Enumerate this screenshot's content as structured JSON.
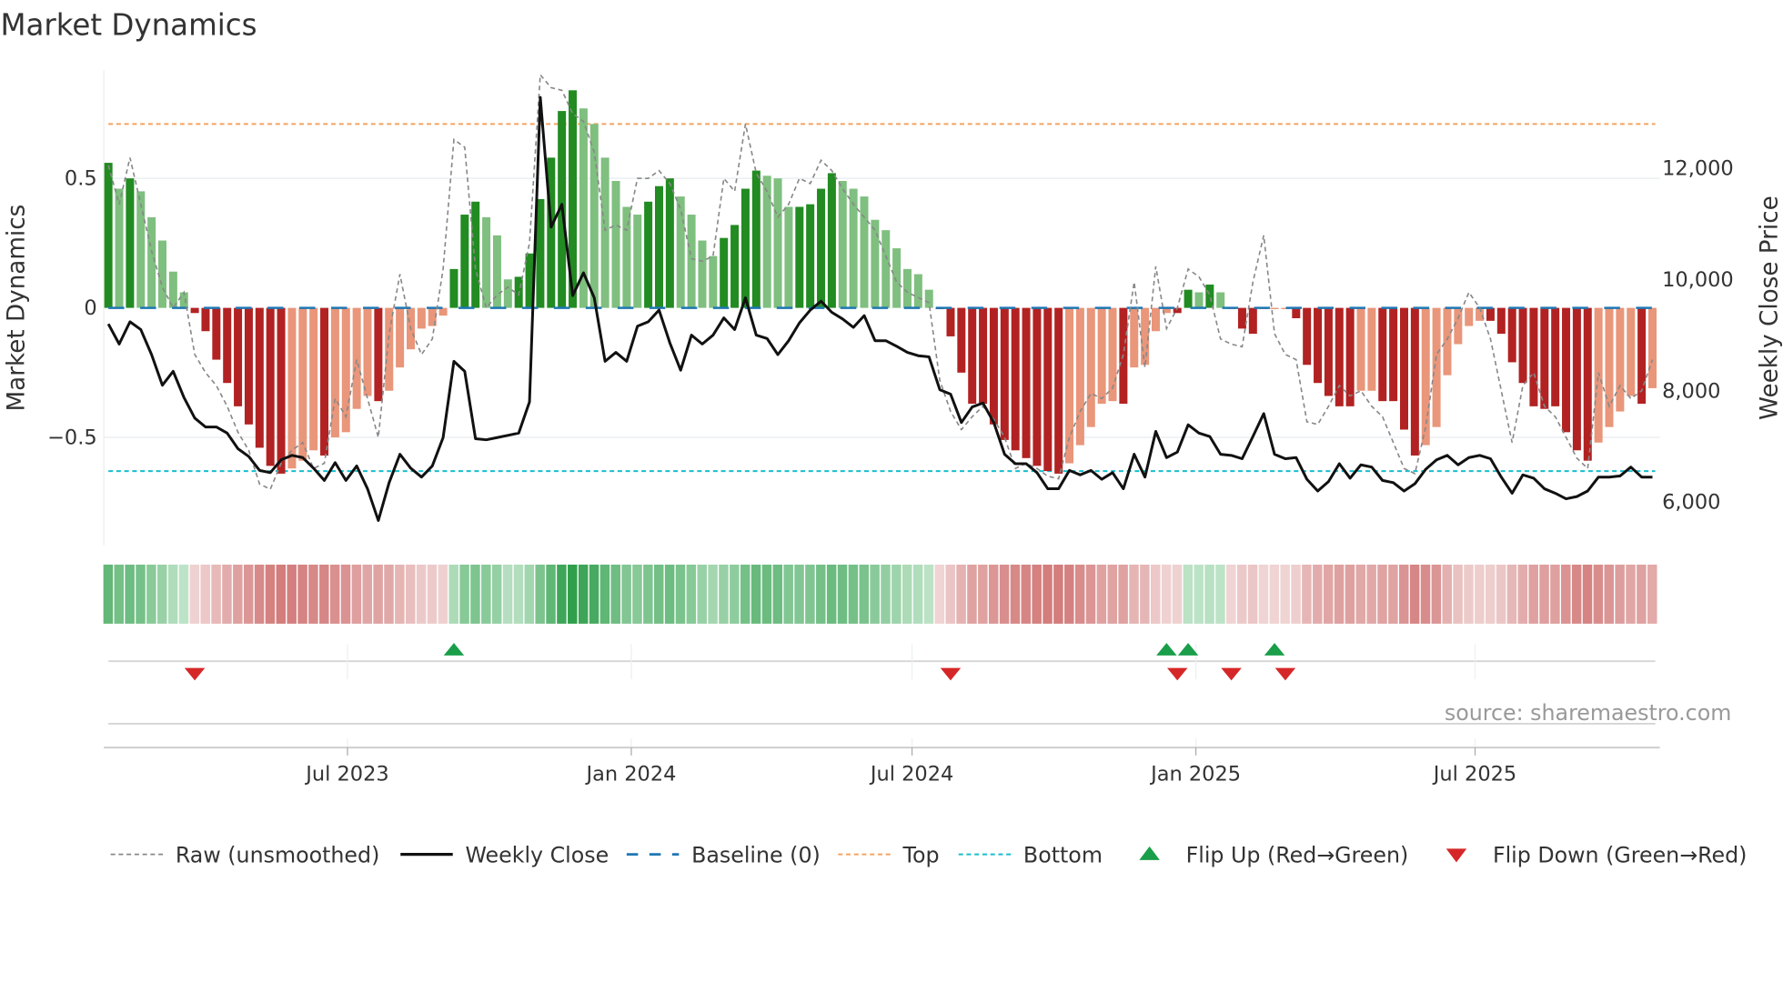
{
  "chart_data": {
    "type": "bar",
    "title": "Market Dynamics",
    "ylabel": "Market Dynamics",
    "y2label": "Weekly Close Price",
    "ylim": [
      -0.92,
      0.92
    ],
    "y2lim": [
      5200,
      13900
    ],
    "yticks": [
      {
        "v": 0.5,
        "label": "0.5"
      },
      {
        "v": 0,
        "label": "0"
      },
      {
        "v": -0.5,
        "label": "−0.5"
      }
    ],
    "y2ticks": [
      {
        "v": 12000,
        "label": "12,000"
      },
      {
        "v": 10000,
        "label": "10,000"
      },
      {
        "v": 8000,
        "label": "8,000"
      },
      {
        "v": 6000,
        "label": "6,000"
      }
    ],
    "x_start": "2023-01-27",
    "x_step_days": 7,
    "xticks": [
      {
        "date": "2023-07-01",
        "label": "Jul 2023"
      },
      {
        "date": "2024-01-01",
        "label": "Jan 2024"
      },
      {
        "date": "2024-07-01",
        "label": "Jul 2024"
      },
      {
        "date": "2025-01-01",
        "label": "Jan 2025"
      },
      {
        "date": "2025-07-01",
        "label": "Jul 2025"
      }
    ],
    "top_level": 0.71,
    "bottom_level": -0.63,
    "baseline": 0,
    "dynamics": [
      0.56,
      0.46,
      0.5,
      0.45,
      0.35,
      0.26,
      0.14,
      0.06,
      -0.02,
      -0.09,
      -0.2,
      -0.29,
      -0.38,
      -0.45,
      -0.54,
      -0.61,
      -0.64,
      -0.62,
      -0.59,
      -0.55,
      -0.57,
      -0.5,
      -0.48,
      -0.39,
      -0.34,
      -0.36,
      -0.32,
      -0.23,
      -0.16,
      -0.08,
      -0.07,
      -0.03,
      0.15,
      0.36,
      0.41,
      0.35,
      0.28,
      0.11,
      0.12,
      0.21,
      0.42,
      0.58,
      0.76,
      0.84,
      0.77,
      0.71,
      0.58,
      0.49,
      0.39,
      0.36,
      0.41,
      0.47,
      0.5,
      0.43,
      0.36,
      0.26,
      0.2,
      0.27,
      0.32,
      0.46,
      0.53,
      0.51,
      0.5,
      0.39,
      0.39,
      0.4,
      0.46,
      0.52,
      0.49,
      0.46,
      0.43,
      0.34,
      0.3,
      0.23,
      0.15,
      0.13,
      0.07,
      -0.005,
      -0.11,
      -0.25,
      -0.37,
      -0.37,
      -0.45,
      -0.51,
      -0.55,
      -0.58,
      -0.61,
      -0.63,
      -0.64,
      -0.6,
      -0.53,
      -0.46,
      -0.37,
      -0.36,
      -0.37,
      -0.23,
      -0.22,
      -0.09,
      -0.02,
      -0.02,
      0.07,
      0.06,
      0.09,
      0.06,
      -0.005,
      -0.08,
      -0.1,
      -0.005,
      -0.005,
      -0.005,
      -0.04,
      -0.22,
      -0.29,
      -0.34,
      -0.38,
      -0.38,
      -0.32,
      -0.32,
      -0.36,
      -0.36,
      -0.47,
      -0.57,
      -0.53,
      -0.46,
      -0.26,
      -0.14,
      -0.07,
      -0.05,
      -0.05,
      -0.1,
      -0.21,
      -0.29,
      -0.38,
      -0.39,
      -0.38,
      -0.48,
      -0.55,
      -0.59,
      -0.52,
      -0.46,
      -0.4,
      -0.34,
      -0.37,
      -0.31
    ],
    "strong": [
      1,
      0,
      1,
      0,
      0,
      0,
      0,
      0,
      1,
      1,
      1,
      1,
      1,
      1,
      1,
      1,
      1,
      0,
      0,
      0,
      1,
      0,
      0,
      0,
      0,
      1,
      0,
      0,
      0,
      0,
      0,
      0,
      1,
      1,
      1,
      0,
      0,
      0,
      1,
      1,
      1,
      1,
      1,
      1,
      0,
      0,
      0,
      0,
      0,
      0,
      1,
      1,
      1,
      0,
      0,
      0,
      0,
      1,
      1,
      1,
      1,
      0,
      0,
      0,
      1,
      1,
      1,
      1,
      0,
      0,
      0,
      0,
      0,
      0,
      0,
      0,
      0,
      1,
      1,
      1,
      1,
      1,
      1,
      1,
      1,
      1,
      1,
      1,
      1,
      0,
      0,
      0,
      0,
      0,
      1,
      0,
      0,
      0,
      0,
      1,
      1,
      0,
      1,
      0,
      0,
      1,
      1,
      0,
      0,
      0,
      1,
      1,
      1,
      1,
      1,
      1,
      0,
      0,
      1,
      1,
      1,
      1,
      0,
      0,
      0,
      0,
      0,
      0,
      1,
      1,
      1,
      1,
      1,
      1,
      1,
      1,
      1,
      1,
      0,
      0,
      0,
      0,
      1,
      0
    ],
    "raw": [
      0.55,
      0.4,
      0.58,
      0.4,
      0.22,
      0.08,
      0.0,
      0.06,
      -0.18,
      -0.25,
      -0.3,
      -0.38,
      -0.48,
      -0.55,
      -0.68,
      -0.7,
      -0.6,
      -0.55,
      -0.52,
      -0.62,
      -0.6,
      -0.35,
      -0.42,
      -0.2,
      -0.35,
      -0.5,
      -0.1,
      0.13,
      -0.08,
      -0.18,
      -0.12,
      0.15,
      0.65,
      0.62,
      0.15,
      0.0,
      0.05,
      0.08,
      0.05,
      0.25,
      0.9,
      0.85,
      0.84,
      0.75,
      0.72,
      0.6,
      0.3,
      0.32,
      0.3,
      0.5,
      0.5,
      0.53,
      0.48,
      0.38,
      0.19,
      0.18,
      0.2,
      0.5,
      0.45,
      0.71,
      0.52,
      0.45,
      0.35,
      0.4,
      0.5,
      0.48,
      0.57,
      0.53,
      0.46,
      0.4,
      0.35,
      0.3,
      0.2,
      0.1,
      0.06,
      0.04,
      0.02,
      -0.28,
      -0.4,
      -0.47,
      -0.42,
      -0.38,
      -0.43,
      -0.5,
      -0.62,
      -0.6,
      -0.62,
      -0.65,
      -0.66,
      -0.5,
      -0.4,
      -0.33,
      -0.35,
      -0.31,
      -0.18,
      0.1,
      -0.23,
      0.16,
      -0.08,
      0.0,
      0.15,
      0.12,
      0.05,
      -0.12,
      -0.14,
      -0.15,
      0.1,
      0.28,
      -0.1,
      -0.18,
      -0.2,
      -0.44,
      -0.45,
      -0.38,
      -0.3,
      -0.34,
      -0.32,
      -0.38,
      -0.42,
      -0.52,
      -0.62,
      -0.64,
      -0.46,
      -0.18,
      -0.12,
      -0.04,
      0.06,
      0.0,
      -0.12,
      -0.32,
      -0.52,
      -0.3,
      -0.25,
      -0.38,
      -0.42,
      -0.5,
      -0.58,
      -0.62,
      -0.25,
      -0.38,
      -0.3,
      -0.35,
      -0.32,
      -0.2
    ],
    "weekly_close": [
      9200,
      8840,
      9240,
      9100,
      8650,
      8100,
      8350,
      7880,
      7510,
      7350,
      7350,
      7240,
      6960,
      6820,
      6570,
      6530,
      6760,
      6840,
      6800,
      6610,
      6390,
      6710,
      6390,
      6650,
      6240,
      5670,
      6350,
      6860,
      6610,
      6450,
      6650,
      7160,
      8530,
      8350,
      7140,
      7120,
      7160,
      7200,
      7240,
      7800,
      13270,
      10940,
      11350,
      9710,
      10120,
      9670,
      8530,
      8690,
      8530,
      9160,
      9240,
      9450,
      8860,
      8370,
      9000,
      8840,
      9000,
      9310,
      9100,
      9670,
      9000,
      8940,
      8650,
      8900,
      9220,
      9450,
      9610,
      9410,
      9290,
      9140,
      9350,
      8900,
      8900,
      8800,
      8690,
      8630,
      8610,
      8020,
      7940,
      7430,
      7710,
      7780,
      7430,
      6860,
      6690,
      6690,
      6530,
      6240,
      6240,
      6570,
      6490,
      6570,
      6410,
      6530,
      6240,
      6860,
      6450,
      7270,
      6800,
      6900,
      7390,
      7240,
      7180,
      6860,
      6840,
      6780,
      7180,
      7590,
      6860,
      6780,
      6800,
      6410,
      6200,
      6370,
      6690,
      6430,
      6670,
      6630,
      6390,
      6350,
      6200,
      6330,
      6590,
      6760,
      6840,
      6670,
      6800,
      6840,
      6780,
      6450,
      6160,
      6490,
      6430,
      6240,
      6160,
      6060,
      6100,
      6200,
      6450,
      6450,
      6470,
      6630,
      6450,
      6450
    ],
    "flip_up": [
      "2023-09-08",
      "2024-12-13",
      "2024-12-27",
      "2025-02-21"
    ],
    "flip_down": [
      "2023-03-24",
      "2024-07-26",
      "2024-12-20",
      "2025-01-24",
      "2025-02-28"
    ],
    "legend": [
      {
        "label": "Raw (unsmoothed)",
        "kind": "raw"
      },
      {
        "label": "Weekly Close",
        "kind": "close"
      },
      {
        "label": "Baseline (0)",
        "kind": "baseline"
      },
      {
        "label": "Top",
        "kind": "top"
      },
      {
        "label": "Bottom",
        "kind": "bottom"
      },
      {
        "label": "Flip Up (Red→Green)",
        "kind": "up"
      },
      {
        "label": "Flip Down (Green→Red)",
        "kind": "down"
      }
    ],
    "legend_position": "bottom",
    "source": "source: sharemaestro.com",
    "colors": {
      "pos_strong": "#228b22",
      "pos_weak": "#7fbf7f",
      "neg_strong": "#b22222",
      "neg_weak": "#e9967a",
      "close": "#111111",
      "raw": "#888888",
      "baseline": "#1f77b4",
      "top": "#f4a460",
      "bottom": "#17becf",
      "up": "#1a9e4a",
      "down": "#d62728"
    }
  }
}
